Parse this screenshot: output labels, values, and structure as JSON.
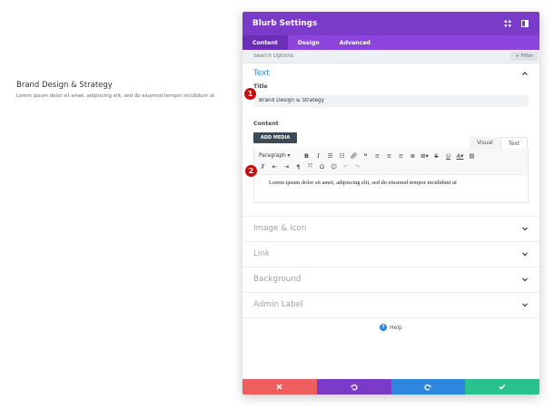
{
  "preview": {
    "title": "Brand Design & Strategy",
    "body": "Lorem ipsum dolor sit amet, adipiscing elit, sed do eiusmod tempor incididunt ut"
  },
  "modal": {
    "title": "Blurb Settings",
    "tabs": [
      {
        "label": "Content"
      },
      {
        "label": "Design"
      },
      {
        "label": "Advanced"
      }
    ],
    "search_placeholder": "Search Options",
    "filter_label": "+ Filter"
  },
  "text_section": {
    "label": "Text",
    "title_field_label": "Title",
    "title_value": "Brand Design & Strategy",
    "content_label": "Content",
    "add_media": "ADD MEDIA",
    "editor_tab_visual": "Visual",
    "editor_tab_text": "Text",
    "paragraph_select": "Paragraph",
    "editor_content": "Lorem ipsum dolor sit amet, adipiscing elit, sed do eiusmod tempor incididunt ut"
  },
  "collapsed_sections": [
    {
      "label": "Image & Icon"
    },
    {
      "label": "Link"
    },
    {
      "label": "Background"
    },
    {
      "label": "Admin Label"
    }
  ],
  "help_label": "Help",
  "badges": [
    "1",
    "2"
  ],
  "colors": {
    "header": "#7b3bc9",
    "tabs": "#8b45dd",
    "active_tab": "#6c2eb9",
    "accent_blue": "#2b87da",
    "cancel": "#ef5e5e",
    "undo": "#7b3bc9",
    "redo": "#2e86de",
    "save": "#29c28f",
    "badge": "#c30f0f"
  },
  "footer": {
    "icons": [
      "close-icon",
      "undo-icon",
      "redo-icon",
      "check-icon"
    ]
  }
}
